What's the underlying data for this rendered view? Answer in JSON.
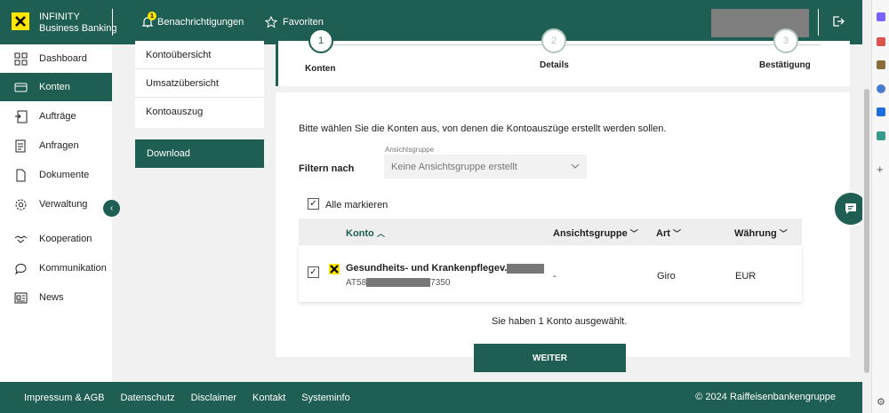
{
  "header": {
    "brand_line1": "INFINITY",
    "brand_line2": "Business Banking",
    "notification_label": "Benachrichtigungen",
    "notification_badge": "1",
    "favorites_label": "Favoriten",
    "logo_icon": "raiffeisen-logo",
    "logout_icon": "logout-icon"
  },
  "sidebar": {
    "items": [
      {
        "label": "Dashboard",
        "icon": "dashboard-icon"
      },
      {
        "label": "Konten",
        "icon": "accounts-icon"
      },
      {
        "label": "Aufträge",
        "icon": "orders-icon"
      },
      {
        "label": "Anfragen",
        "icon": "requests-icon"
      },
      {
        "label": "Dokumente",
        "icon": "documents-icon"
      },
      {
        "label": "Verwaltung",
        "icon": "settings-icon"
      },
      {
        "label": "Kooperation",
        "icon": "handshake-icon"
      },
      {
        "label": "Kommunikation",
        "icon": "chat-icon"
      },
      {
        "label": "News",
        "icon": "news-icon"
      }
    ],
    "active_index": 1
  },
  "submenu": {
    "items": [
      "Kontoübersicht",
      "Umsatzübersicht",
      "Kontoauszug"
    ],
    "download": "Download"
  },
  "stepper": {
    "steps": [
      {
        "number": "1",
        "label": "Konten"
      },
      {
        "number": "2",
        "label": "Details"
      },
      {
        "number": "3",
        "label": "Bestätigung"
      }
    ],
    "current_step": 1
  },
  "content": {
    "instruction": "Bitte wählen Sie die Konten aus, von denen die Kontoauszüge erstellt werden sollen.",
    "filter_label": "Filtern nach",
    "dropdown_label": "Ansichtsgruppe",
    "dropdown_value": "Keine Ansichtsgruppe erstellt",
    "select_all_label": "Alle markieren",
    "select_all_checked": true,
    "table": {
      "headers": [
        "Konto",
        "Ansichtsgruppe",
        "Art",
        "Währung"
      ],
      "rows": [
        {
          "checked": true,
          "name": "Gesundheits- und Krankenpflegev.",
          "iban_prefix": "AT58",
          "iban_suffix": "7350",
          "group": "-",
          "type": "Giro",
          "currency": "EUR"
        }
      ]
    },
    "selected_info": "Sie haben 1 Konto ausgewählt.",
    "next_button": "WEITER"
  },
  "footer": {
    "links": [
      "Impressum & AGB",
      "Datenschutz",
      "Disclaimer",
      "Kontakt",
      "Systeminfo"
    ],
    "copyright": "© 2024 Raiffeisenbankengruppe"
  },
  "colors": {
    "primary": "#1f5e52",
    "logo_yellow": "#ffe600"
  }
}
